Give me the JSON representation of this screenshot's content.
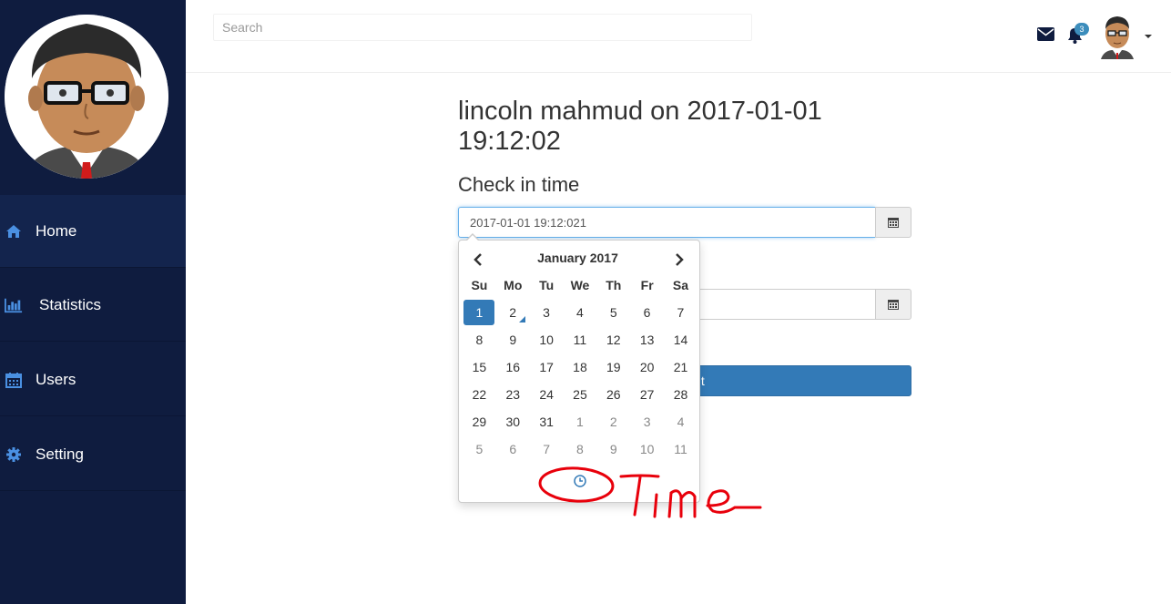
{
  "sidebar": {
    "items": [
      {
        "label": "Home",
        "icon": "home-icon",
        "active": true
      },
      {
        "label": "Statistics",
        "icon": "bar-chart-icon",
        "active": false
      },
      {
        "label": "Users",
        "icon": "calendar-icon",
        "active": false
      },
      {
        "label": "Setting",
        "icon": "gear-icon",
        "active": false
      }
    ]
  },
  "header": {
    "search_placeholder": "Search",
    "notification_count": "3"
  },
  "main": {
    "title": "lincoln mahmud on 2017-01-01 19:12:02",
    "checkin_label": "Check in time",
    "checkin_value": "2017-01-01 19:12:021",
    "checkout_value": "",
    "submit_label": "Submit"
  },
  "datepicker": {
    "month_title": "January 2017",
    "weekdays": [
      "Su",
      "Mo",
      "Tu",
      "We",
      "Th",
      "Fr",
      "Sa"
    ],
    "weeks": [
      [
        {
          "d": "1",
          "s": "active"
        },
        {
          "d": "2",
          "s": "today"
        },
        {
          "d": "3"
        },
        {
          "d": "4"
        },
        {
          "d": "5"
        },
        {
          "d": "6"
        },
        {
          "d": "7"
        }
      ],
      [
        {
          "d": "8"
        },
        {
          "d": "9"
        },
        {
          "d": "10"
        },
        {
          "d": "11"
        },
        {
          "d": "12"
        },
        {
          "d": "13"
        },
        {
          "d": "14"
        }
      ],
      [
        {
          "d": "15"
        },
        {
          "d": "16"
        },
        {
          "d": "17"
        },
        {
          "d": "18"
        },
        {
          "d": "19"
        },
        {
          "d": "20"
        },
        {
          "d": "21"
        }
      ],
      [
        {
          "d": "22"
        },
        {
          "d": "23"
        },
        {
          "d": "24"
        },
        {
          "d": "25"
        },
        {
          "d": "26"
        },
        {
          "d": "27"
        },
        {
          "d": "28"
        }
      ],
      [
        {
          "d": "29"
        },
        {
          "d": "30"
        },
        {
          "d": "31"
        },
        {
          "d": "1",
          "s": "muted"
        },
        {
          "d": "2",
          "s": "muted"
        },
        {
          "d": "3",
          "s": "muted"
        },
        {
          "d": "4",
          "s": "muted"
        }
      ],
      [
        {
          "d": "5",
          "s": "muted"
        },
        {
          "d": "6",
          "s": "muted"
        },
        {
          "d": "7",
          "s": "muted"
        },
        {
          "d": "8",
          "s": "muted"
        },
        {
          "d": "9",
          "s": "muted"
        },
        {
          "d": "10",
          "s": "muted"
        },
        {
          "d": "11",
          "s": "muted"
        }
      ]
    ]
  },
  "annotation": {
    "text": "Time",
    "color": "#e8000b"
  },
  "colors": {
    "sidebar_bg": "#0f1c3f",
    "accent": "#337ab7",
    "nav_icon": "#4a90e2"
  }
}
